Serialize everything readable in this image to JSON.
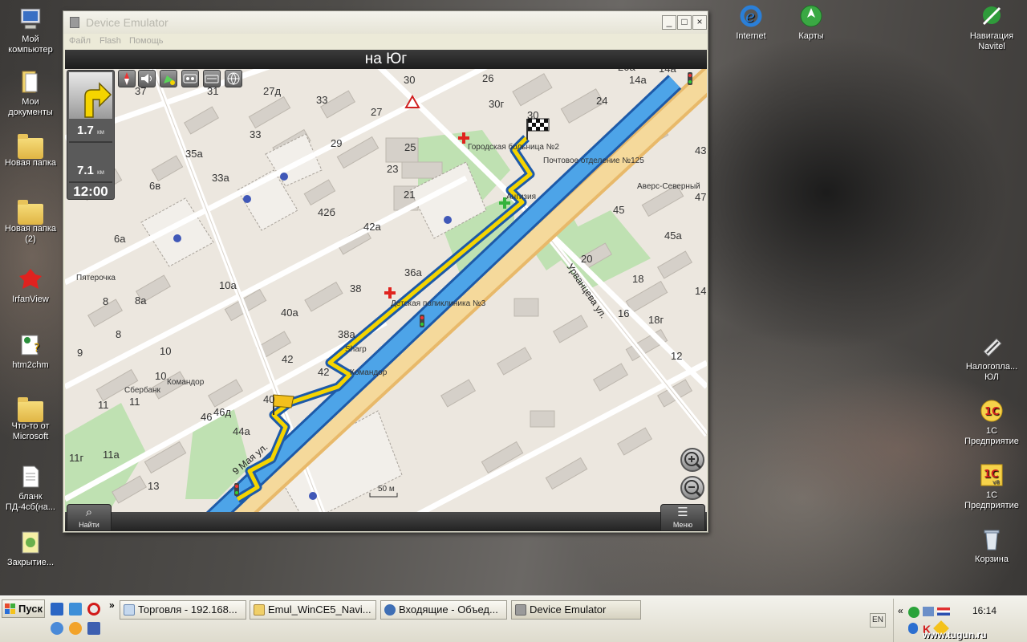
{
  "desktop": {
    "left_icons": [
      {
        "label": "Мой компьютер",
        "icon": "computer-icon"
      },
      {
        "label": "Мои документы",
        "icon": "documents-folder-icon"
      },
      {
        "label": "Новая папка",
        "icon": "folder-icon"
      },
      {
        "label": "Новая папка (2)",
        "icon": "folder-icon"
      },
      {
        "label": "IrfanView",
        "icon": "irfanview-icon"
      },
      {
        "label": "htm2chm",
        "icon": "htm2chm-icon"
      },
      {
        "label": "Что-то от Microsoft",
        "icon": "folder-icon"
      },
      {
        "label": "бланк ПД-4сб(на...",
        "icon": "document-icon"
      },
      {
        "label": "Закрытие...",
        "icon": "shortcut-icon"
      }
    ],
    "top_icons": [
      {
        "label": "Internet",
        "icon": "internet-explorer-icon"
      },
      {
        "label": "Карты",
        "icon": "maps-icon"
      }
    ],
    "right_icons": [
      {
        "label": "Навигация Navitel",
        "icon": "navitel-icon"
      },
      {
        "label": "Налогопла... ЮЛ",
        "icon": "tax-icon"
      },
      {
        "label": "1С Предприятие",
        "icon": "1c-icon"
      },
      {
        "label": "1С Предприятие",
        "icon": "1c-v8-icon"
      },
      {
        "label": "Корзина",
        "icon": "recycle-bin-icon"
      }
    ]
  },
  "emulator": {
    "title": "Device Emulator",
    "controls": {
      "minimize": "_",
      "maximize": "□",
      "close": "×"
    },
    "menu": [
      "Файл",
      "Flash",
      "Помощь"
    ]
  },
  "navigator": {
    "street_header": "на Юг",
    "next_turn_distance": "1.7",
    "total_distance": "7.1",
    "distance_unit": "км",
    "eta": "12:00",
    "scale_label": "50 м",
    "softkeys": {
      "find": "Найти",
      "menu": "Меню"
    },
    "top_icons": [
      "compass-icon",
      "volume-icon",
      "gps-icon",
      "cassette-icon",
      "keyboard-icon",
      "globe-icon"
    ],
    "street_names": [
      "Урванцева ул.",
      "9 Мая ул."
    ],
    "pois": [
      "Городская больница №2",
      "Почтовое отделение №125",
      "Аверс-Северный",
      "Ангизия",
      "Пятерочка",
      "Детская поликлиника №3",
      "Sharp",
      "Командор",
      "Командор",
      "Сбербанк"
    ],
    "house_numbers": [
      "29",
      "27г",
      "28",
      "20а",
      "14а",
      "14а",
      "37",
      "31",
      "27д",
      "30",
      "26",
      "33",
      "30г",
      "24",
      "30",
      "27",
      "33",
      "29",
      "25",
      "23",
      "43",
      "35а",
      "33а",
      "6в",
      "21",
      "47",
      "42б",
      "42а",
      "45",
      "45а",
      "6а",
      "36а",
      "20",
      "18",
      "10а",
      "38",
      "40а",
      "16",
      "18г",
      "14",
      "8",
      "8а",
      "8",
      "9",
      "10",
      "38а",
      "42",
      "12",
      "10",
      "42",
      "11",
      "11",
      "40",
      "46",
      "46д",
      "44а",
      "11г",
      "11а",
      "13",
      "16"
    ]
  },
  "taskbar": {
    "start": "Пуск",
    "more": "»",
    "tasks": [
      "Торговля - 192.168...",
      "Emul_WinCE5_Navi...",
      "Входящие - Объед...",
      "Device Emulator"
    ],
    "language": "EN",
    "tray_more": "«",
    "clock": "16:14"
  },
  "watermark": "www.tugun.ru"
}
